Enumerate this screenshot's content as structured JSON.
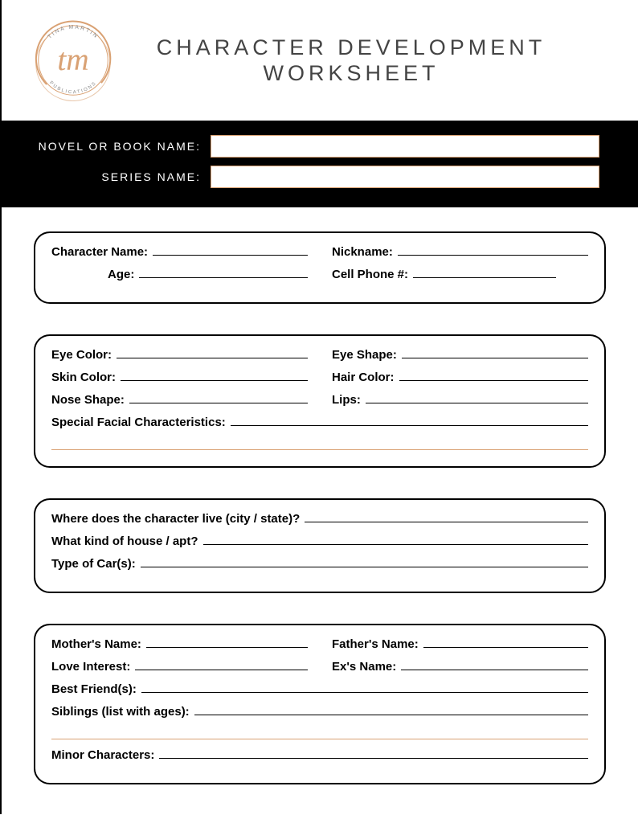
{
  "logo": {
    "top_text": "TINA MARTIN",
    "center_text": "tm",
    "bottom_text": "PUBLICATIONS"
  },
  "title": {
    "line1": "CHARACTER DEVELOPMENT",
    "line2": "WORKSHEET"
  },
  "black_bar": {
    "novel_label": "NOVEL OR BOOK NAME:",
    "series_label": "SERIES NAME:"
  },
  "card1": {
    "character_name": "Character Name:",
    "nickname": "Nickname:",
    "age": "Age:",
    "cell_phone": "Cell Phone #:"
  },
  "card2": {
    "eye_color": "Eye Color:",
    "eye_shape": "Eye Shape:",
    "skin_color": "Skin Color:",
    "hair_color": "Hair Color:",
    "nose_shape": "Nose Shape:",
    "lips": "Lips:",
    "special": "Special Facial Characteristics:"
  },
  "card3": {
    "live": "Where does the character live (city / state)?",
    "house": "What kind of house / apt?",
    "car": "Type of Car(s):"
  },
  "card4": {
    "mother": "Mother's Name:",
    "father": "Father's Name:",
    "love": "Love Interest:",
    "ex": "Ex's Name:",
    "bestfriend": "Best Friend(s):",
    "siblings": "Siblings (list with ages):",
    "minor": "Minor Characters:"
  }
}
